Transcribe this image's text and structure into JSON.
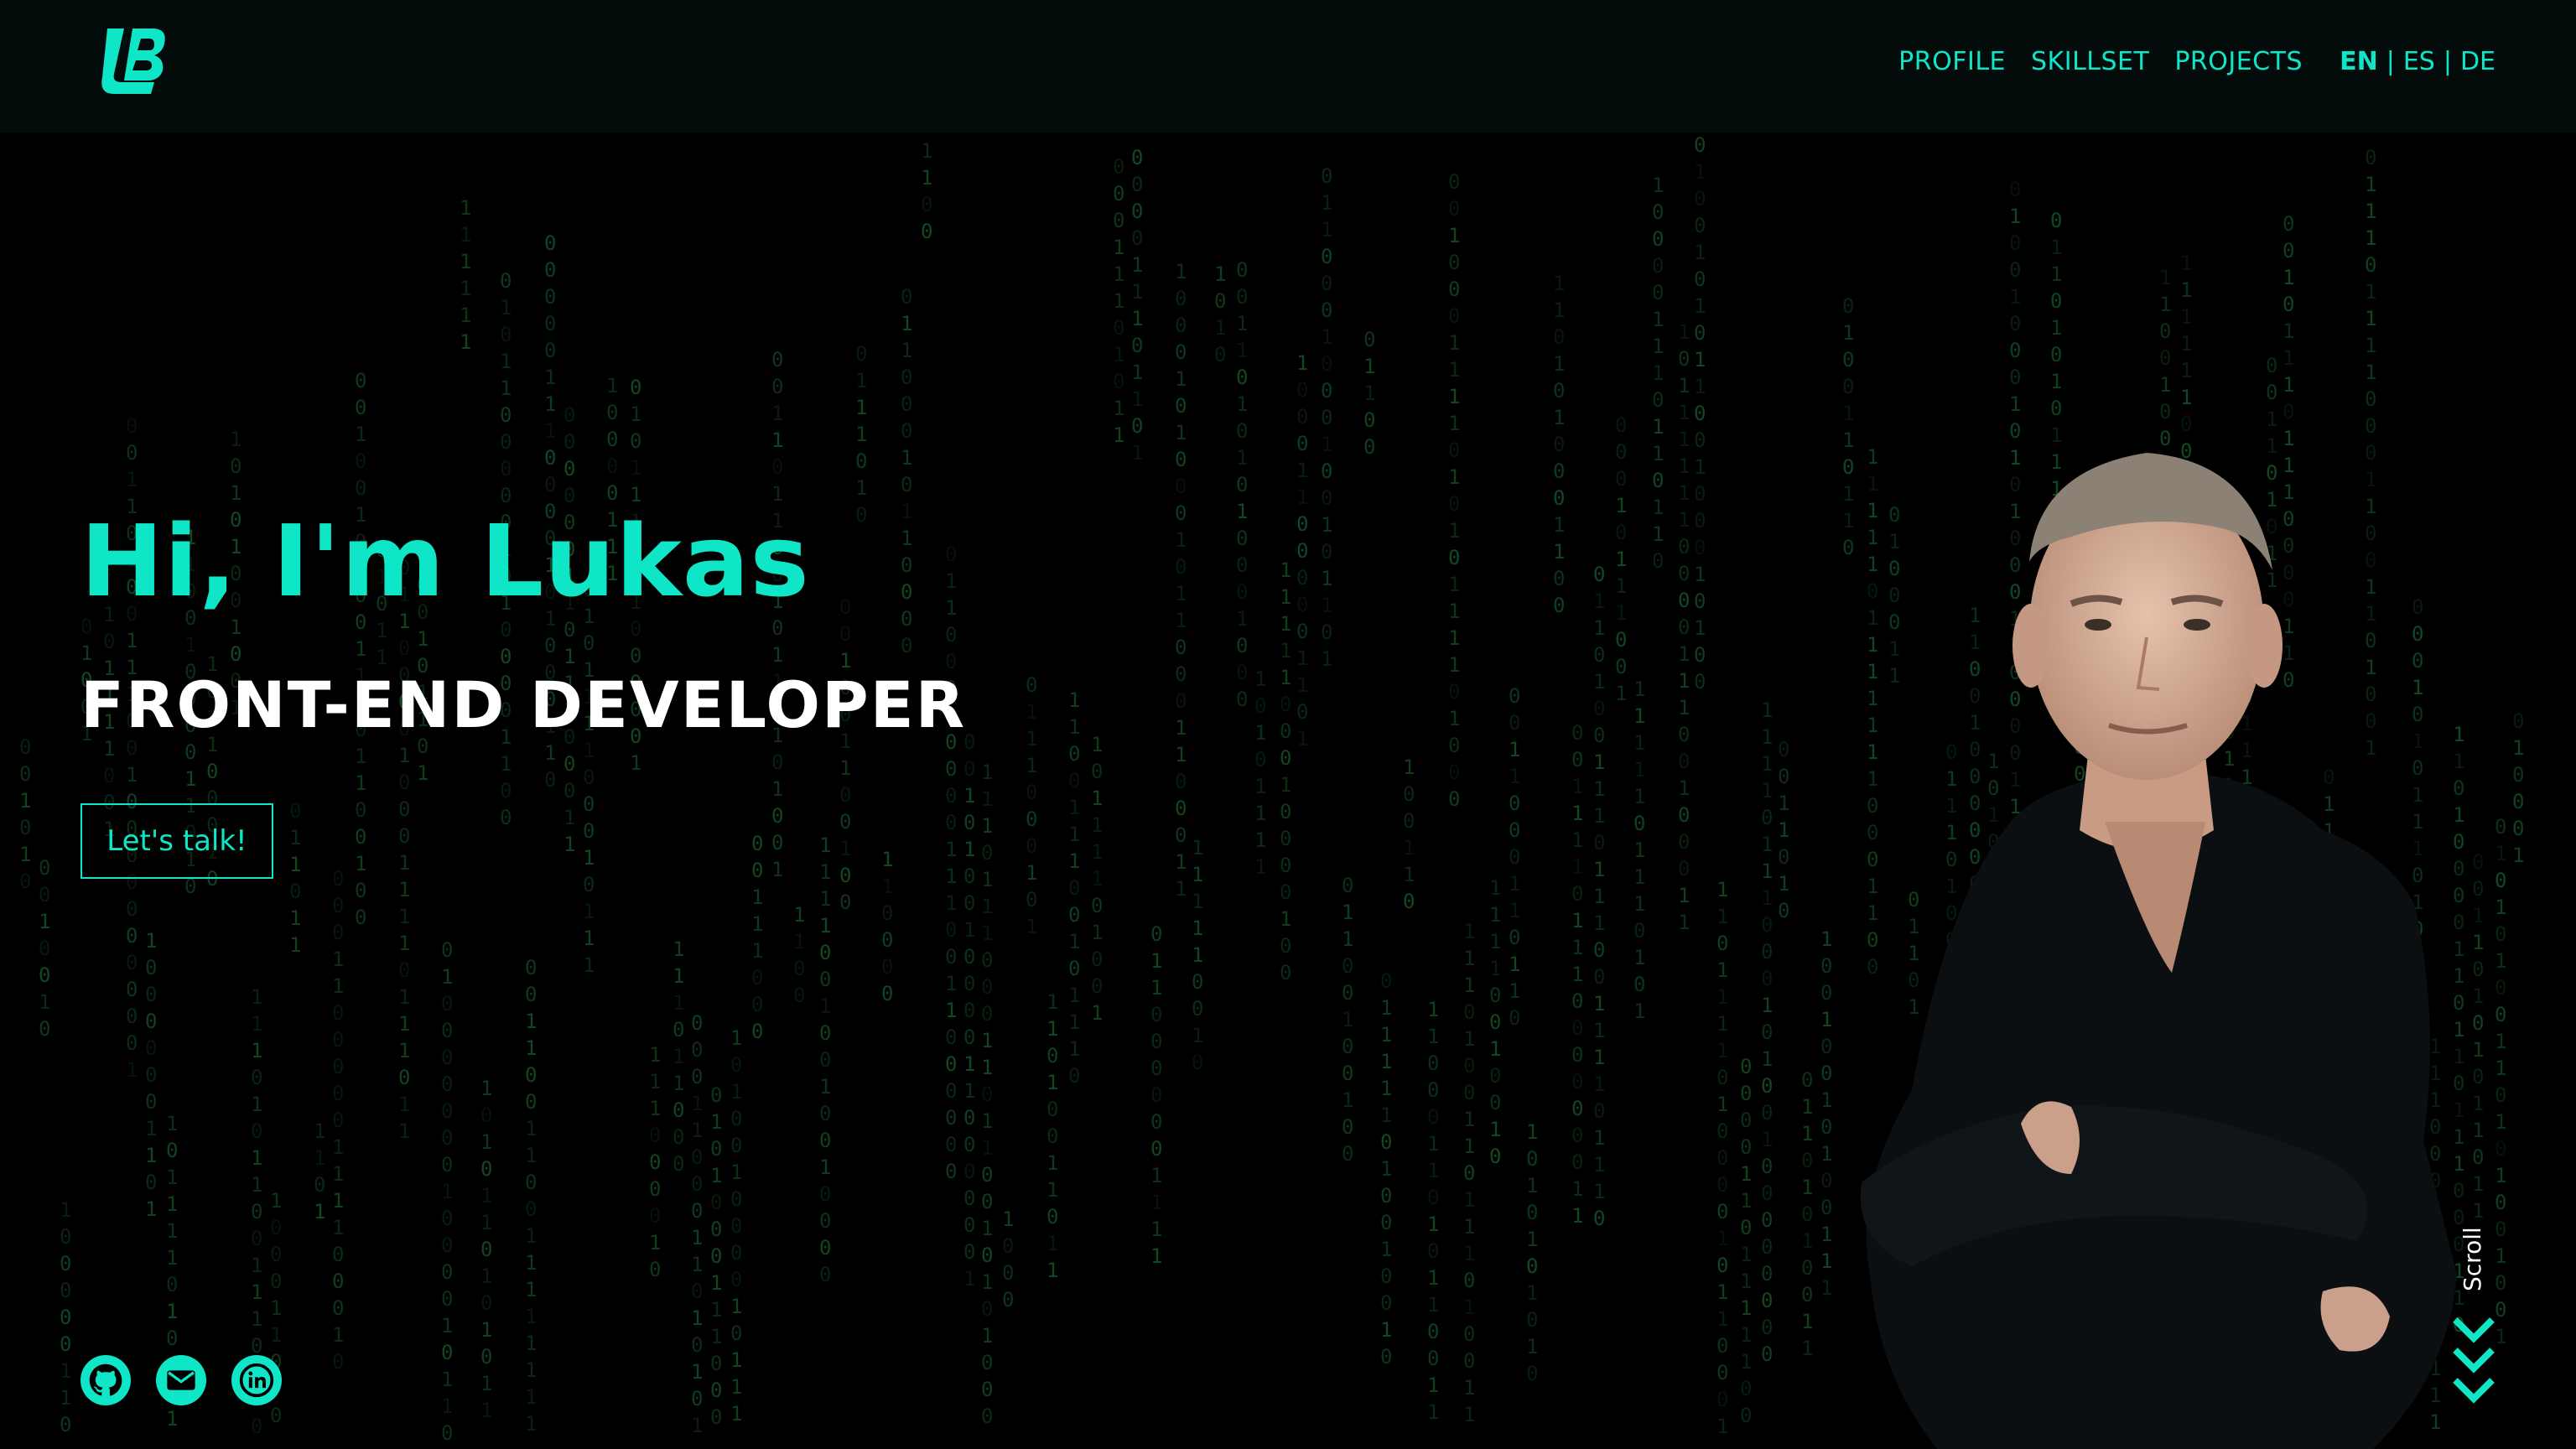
{
  "header": {
    "logo_text": "LB",
    "nav": [
      {
        "label": "PROFILE"
      },
      {
        "label": "SKILLSET"
      },
      {
        "label": "PROJECTS"
      }
    ],
    "languages": [
      {
        "label": "EN",
        "active": true
      },
      {
        "label": "ES",
        "active": false
      },
      {
        "label": "DE",
        "active": false
      }
    ],
    "language_separator": "|"
  },
  "hero": {
    "title": "Hi, I'm Lukas",
    "subtitle": "FRONT-END DEVELOPER",
    "cta_label": "Let's talk!"
  },
  "socials": [
    {
      "icon": "github-icon"
    },
    {
      "icon": "mail-icon"
    },
    {
      "icon": "linkedin-icon"
    }
  ],
  "scroll_label": "Scroll",
  "colors": {
    "accent": "#0ee6c7",
    "background": "#000000",
    "header_bg": "#040b0b",
    "matrix_green": "#1f7a3c",
    "text": "#ffffff"
  }
}
